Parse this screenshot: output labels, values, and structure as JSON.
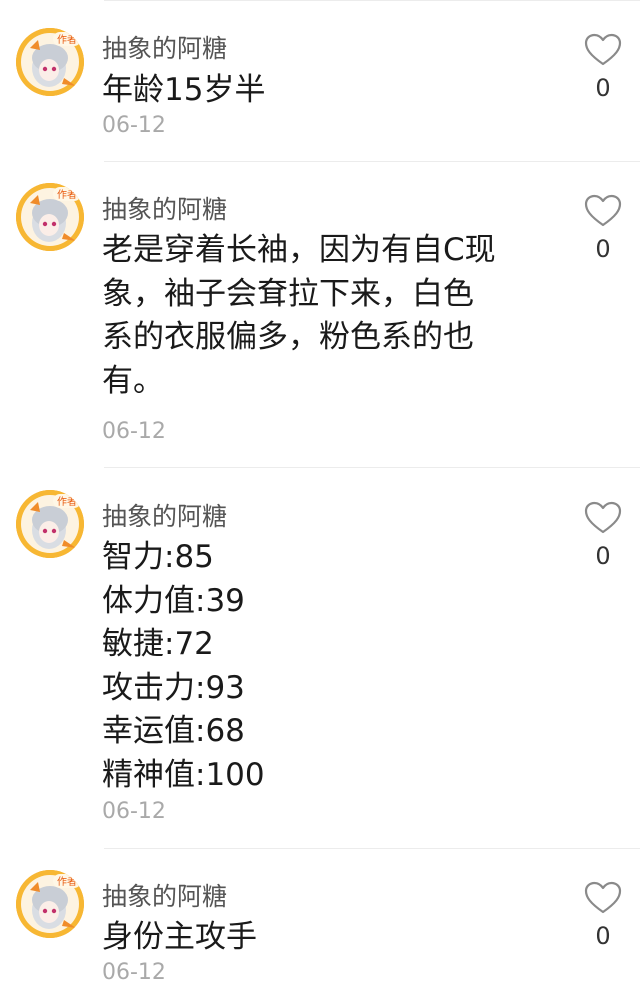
{
  "comments": [
    {
      "author": "抽象的阿糖",
      "badge": "作者",
      "lines": [
        "年龄15岁半"
      ],
      "date": "06-12",
      "likes": "0"
    },
    {
      "author": "抽象的阿糖",
      "badge": "作者",
      "lines": [
        "老是穿着长袖，因为有自C现",
        "象，袖子会耷拉下来，白色",
        "系的衣服偏多，粉色系的也",
        "有。"
      ],
      "date": "06-12",
      "likes": "0"
    },
    {
      "author": "抽象的阿糖",
      "badge": "作者",
      "lines": [
        "智力:85",
        "体力值:39",
        "敏捷:72",
        "攻击力:93",
        "幸运值:68",
        "精神值:100"
      ],
      "date": "06-12",
      "likes": "0"
    },
    {
      "author": "抽象的阿糖",
      "badge": "作者",
      "lines": [
        "身份主攻手"
      ],
      "date": "06-12",
      "likes": "0"
    }
  ],
  "icons": {
    "like": "heart-outline-icon",
    "avatar_badge": "author-badge-icon"
  },
  "colors": {
    "avatar_ring": "#f5a623",
    "badge_text": "#e8590c",
    "date": "#a9a9a9",
    "author": "#555555"
  }
}
